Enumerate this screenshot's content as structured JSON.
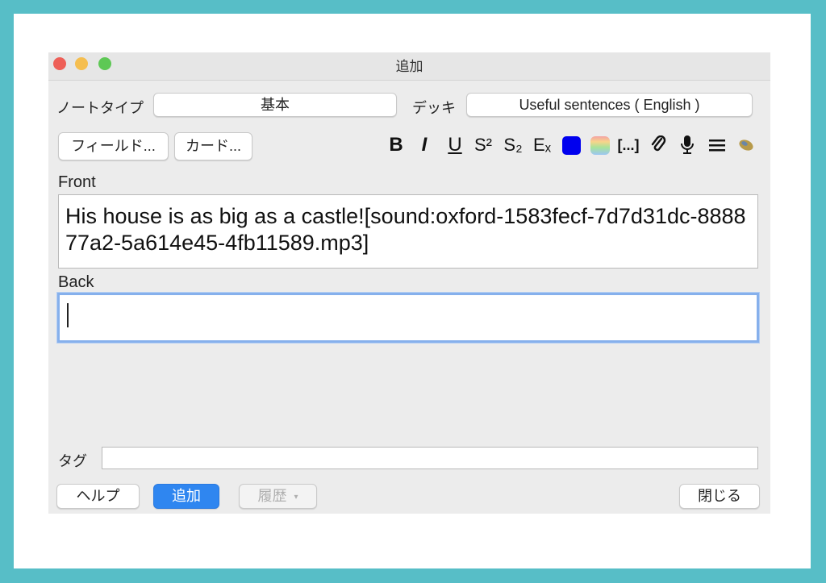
{
  "window": {
    "title": "追加"
  },
  "note_type": {
    "label": "ノートタイプ",
    "value": "基本"
  },
  "deck": {
    "label": "デッキ",
    "value": "Useful sentences ( English )"
  },
  "buttons": {
    "fields": "フィールド...",
    "cards": "カード..."
  },
  "toolbar": {
    "bold": "B",
    "italic": "I",
    "underline": "U",
    "superscript": "S²",
    "subscript": "S₂",
    "clear_format": "Eₓ",
    "cloze": "[...]",
    "text_color": "#0000ee",
    "icons": [
      "bold-icon",
      "italic-icon",
      "underline-icon",
      "superscript-icon",
      "subscript-icon",
      "clear-format-icon",
      "text-color-icon",
      "highlight-color-icon",
      "cloze-icon",
      "attach-icon",
      "record-audio-icon",
      "more-icon",
      "latex-icon"
    ]
  },
  "fields": {
    "front": {
      "label": "Front",
      "value": "His house is as big as a castle![sound:oxford-1583fecf-7d7d31dc-888877a2-5a614e45-4fb11589.mp3]"
    },
    "back": {
      "label": "Back",
      "value": ""
    }
  },
  "tags": {
    "label": "タグ",
    "value": ""
  },
  "footer": {
    "help": "ヘルプ",
    "add": "追加",
    "history": "履歴",
    "close": "閉じる"
  }
}
